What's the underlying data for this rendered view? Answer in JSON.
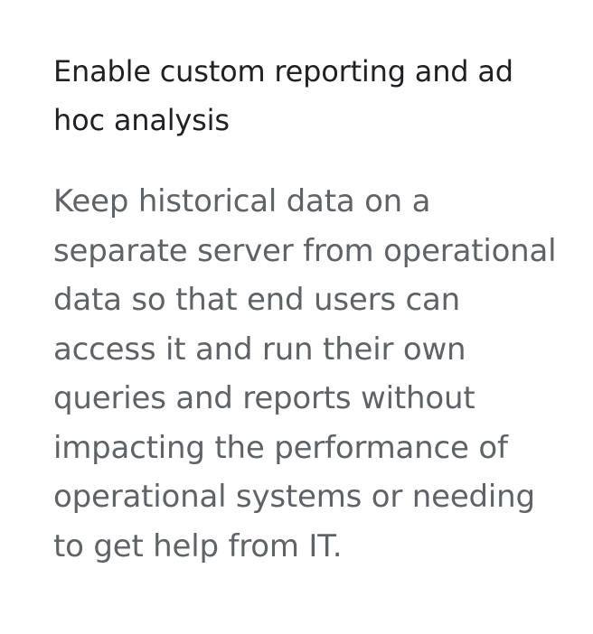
{
  "feature": {
    "title": "Enable custom reporting and ad hoc analysis",
    "description": "Keep historical data on a separate server from operational data so that end users can access it and run their own queries and reports without impacting the performance of operational systems or needing to get help from IT."
  }
}
